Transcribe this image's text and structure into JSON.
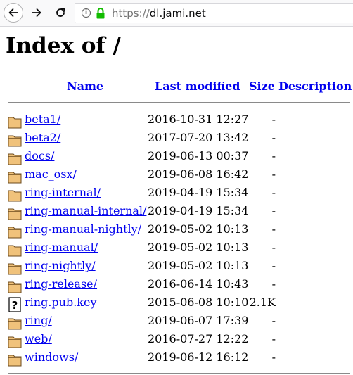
{
  "browser": {
    "url_prefix": "https://",
    "url_host": "dl.jami.net"
  },
  "page": {
    "title": "Index of /"
  },
  "table": {
    "headers": {
      "name": "Name",
      "last_modified": "Last modified",
      "size": "Size",
      "description": "Description"
    },
    "rows": [
      {
        "name": "beta1/",
        "modified": "2016-10-31 12:27",
        "size": "-",
        "type": "folder"
      },
      {
        "name": "beta2/",
        "modified": "2017-07-20 13:42",
        "size": "-",
        "type": "folder"
      },
      {
        "name": "docs/",
        "modified": "2019-06-13 00:37",
        "size": "-",
        "type": "folder"
      },
      {
        "name": "mac_osx/",
        "modified": "2019-06-08 16:42",
        "size": "-",
        "type": "folder"
      },
      {
        "name": "ring-internal/",
        "modified": "2019-04-19 15:34",
        "size": "-",
        "type": "folder"
      },
      {
        "name": "ring-manual-internal/",
        "modified": "2019-04-19 15:34",
        "size": "-",
        "type": "folder"
      },
      {
        "name": "ring-manual-nightly/",
        "modified": "2019-05-02 10:13",
        "size": "-",
        "type": "folder"
      },
      {
        "name": "ring-manual/",
        "modified": "2019-05-02 10:13",
        "size": "-",
        "type": "folder"
      },
      {
        "name": "ring-nightly/",
        "modified": "2019-05-02 10:13",
        "size": "-",
        "type": "folder"
      },
      {
        "name": "ring-release/",
        "modified": "2016-06-14 10:43",
        "size": "-",
        "type": "folder"
      },
      {
        "name": "ring.pub.key",
        "modified": "2015-06-08 10:10",
        "size": "2.1K",
        "type": "unknown"
      },
      {
        "name": "ring/",
        "modified": "2019-06-07 17:39",
        "size": "-",
        "type": "folder"
      },
      {
        "name": "web/",
        "modified": "2016-07-27 12:22",
        "size": "-",
        "type": "folder"
      },
      {
        "name": "windows/",
        "modified": "2019-06-12 16:12",
        "size": "-",
        "type": "folder"
      }
    ]
  },
  "colors": {
    "link": "#0000ee",
    "secure_lock": "#12bc00",
    "folder_fill": "#f0c27b",
    "folder_stroke": "#6b4a1d"
  }
}
